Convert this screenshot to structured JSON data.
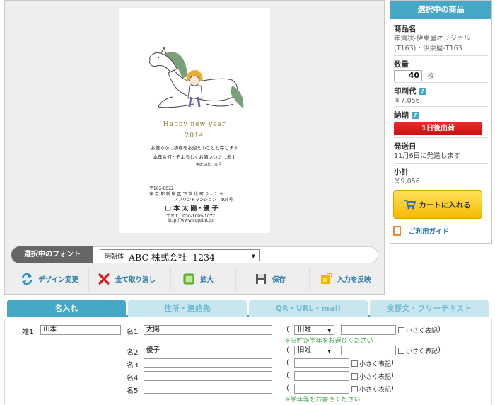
{
  "preview": {
    "card": {
      "greeting_en": "Happy new year",
      "year": "2014",
      "line1": "お健やかに初春をお迎えのことと存じます",
      "line2": "本年も何とぞよろしくお願いいたします",
      "date": "平成26年　元旦",
      "zip": "〒162-0822",
      "address1": "東 京 都 新 宿 区 下 宮 比 町 ２ - ２ ９",
      "address2": "スプリントマンション　404号",
      "names": "山 本 太 陽・優 子",
      "tel": "T E L　050-1009-1072",
      "url": "http://www.suprint.jp"
    },
    "font_bar": {
      "label": "選択中のフォント",
      "selected_prefix": "明朝体",
      "selected_sample": "ABC 株式会社 -1234"
    },
    "tools": [
      {
        "label": "デザイン変更",
        "icon": "refresh-icon"
      },
      {
        "label": "全て取り消し",
        "icon": "close-icon"
      },
      {
        "label": "拡大",
        "icon": "zoom-icon"
      },
      {
        "label": "保存",
        "icon": "save-icon"
      },
      {
        "label": "入力を反映",
        "icon": "apply-icon"
      }
    ]
  },
  "sidebar": {
    "title": "選択中の商品",
    "product_label": "商品名",
    "product_name": "年賀状-伊東屋オリジナル(T163)・伊東屋-T163",
    "quantity_label": "数量",
    "quantity": "40",
    "quantity_unit": "枚",
    "print_fee_label": "印刷代",
    "print_fee": "￥7,056",
    "delivery_label": "納期",
    "delivery_badge": "1日後出荷",
    "ship_date_label": "発送日",
    "ship_date": "11月6日に発送します",
    "subtotal_label": "小計",
    "subtotal": "￥9,056",
    "cart_button": "カートに入れる",
    "guide_link": "ご利用ガイド"
  },
  "tabs": [
    {
      "label": "名入れ",
      "active": true
    },
    {
      "label": "住所・連絡先",
      "active": false
    },
    {
      "label": "QR・URL・mail",
      "active": false
    },
    {
      "label": "挨拶文・フリーテキスト",
      "active": false
    }
  ],
  "form": {
    "surname_label": "姓1",
    "surname_value": "山本",
    "rows": [
      {
        "label": "名1",
        "value": "太陽",
        "old_char": "旧姓",
        "note": "※旧姓か学年をお選びください"
      },
      {
        "label": "名2",
        "value": "優子",
        "old_char": "旧姓"
      },
      {
        "label": "名3",
        "value": ""
      },
      {
        "label": "名4",
        "value": ""
      },
      {
        "label": "名5",
        "value": "",
        "note": "※学年等をお書きください"
      }
    ],
    "small_checkbox_label": "小さく表記"
  },
  "colors": {
    "accent": "#45a8c6",
    "delivery_red": "#e01e1e",
    "cart_yellow": "#ffd21f",
    "note_green": "#3fa34a",
    "link_blue": "#2a7aa8"
  }
}
